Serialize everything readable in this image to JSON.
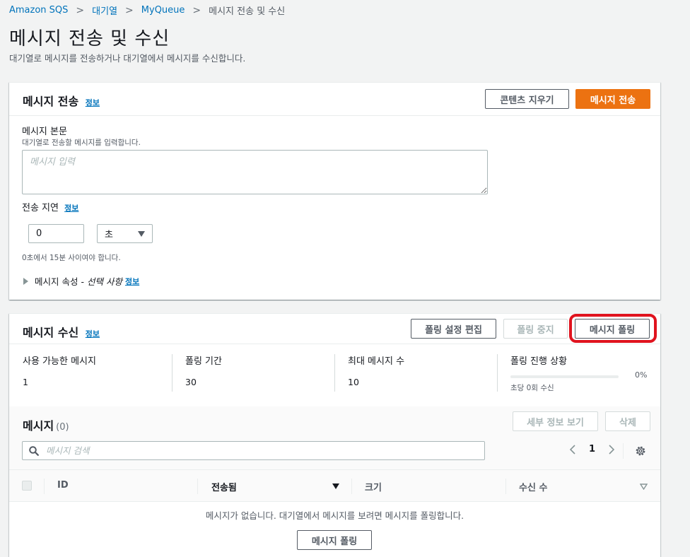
{
  "breadcrumb": {
    "items": [
      "Amazon SQS",
      "대기열",
      "MyQueue"
    ],
    "current": "메시지 전송 및 수신"
  },
  "page": {
    "title": "메시지 전송 및 수신",
    "description": "대기열로 메시지를 전송하거나 대기열에서 메시지를 수신합니다."
  },
  "send": {
    "title": "메시지 전송",
    "info": "정보",
    "clear_button": "콘텐츠 지우기",
    "send_button": "메시지 전송",
    "body_label": "메시지 본문",
    "body_hint": "대기열로 전송할 메시지를 입력합니다.",
    "body_placeholder": "메시지 입력",
    "delay_label": "전송 지연",
    "delay_info": "정보",
    "delay_value": "0",
    "delay_unit": "초",
    "delay_hint": "0초에서 15분 사이여야 합니다.",
    "attributes_label": "메시지 속성 -",
    "attributes_optional": "선택 사항",
    "attributes_info": "정보"
  },
  "receive": {
    "title": "메시지 수신",
    "info": "정보",
    "edit_button": "폴링 설정 편집",
    "stop_button": "폴링 중지",
    "poll_button": "메시지 폴링",
    "stats": [
      {
        "label": "사용 가능한 메시지",
        "value": "1"
      },
      {
        "label": "폴링 기간",
        "value": "30"
      },
      {
        "label": "최대 메시지 수",
        "value": "10"
      }
    ],
    "progress_label": "폴링 진행 상황",
    "progress_percent": "0%",
    "progress_value": 0,
    "progress_sub": "초당 0회 수신"
  },
  "messages": {
    "title": "메시지",
    "count": "(0)",
    "details_button": "세부 정보 보기",
    "delete_button": "삭제",
    "search_placeholder": "메시지 검색",
    "page": "1",
    "columns": [
      "ID",
      "전송됨",
      "크기",
      "수신 수"
    ],
    "empty_text": "메시지가 없습니다. 대기열에서 메시지를 보려면 메시지를 폴링합니다.",
    "empty_button": "메시지 폴링"
  },
  "colors": {
    "primary": "#ec7211",
    "link": "#0073bb",
    "highlight": "#e0131e"
  }
}
